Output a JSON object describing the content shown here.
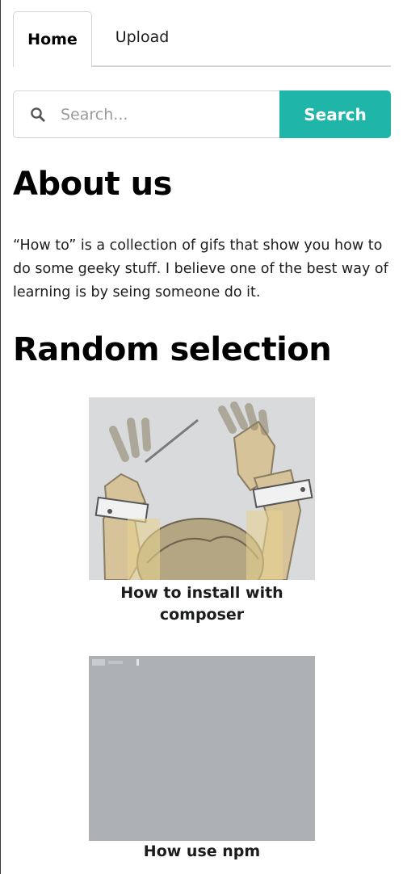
{
  "tabs": [
    {
      "label": "Home",
      "active": true
    },
    {
      "label": "Upload",
      "active": false
    }
  ],
  "search": {
    "placeholder": "Search...",
    "value": "",
    "button_label": "Search",
    "icon": "search-icon",
    "button_color": "#1fb5a9"
  },
  "about": {
    "heading": "About us",
    "text": "“How to” is a collection of gifs that show you how to do some geeky stuff. I believe one of the best way of learning is by seing someone do it."
  },
  "random": {
    "heading": "Random selection",
    "items": [
      {
        "title": "How to install with composer"
      },
      {
        "title": "How use npm"
      }
    ]
  }
}
